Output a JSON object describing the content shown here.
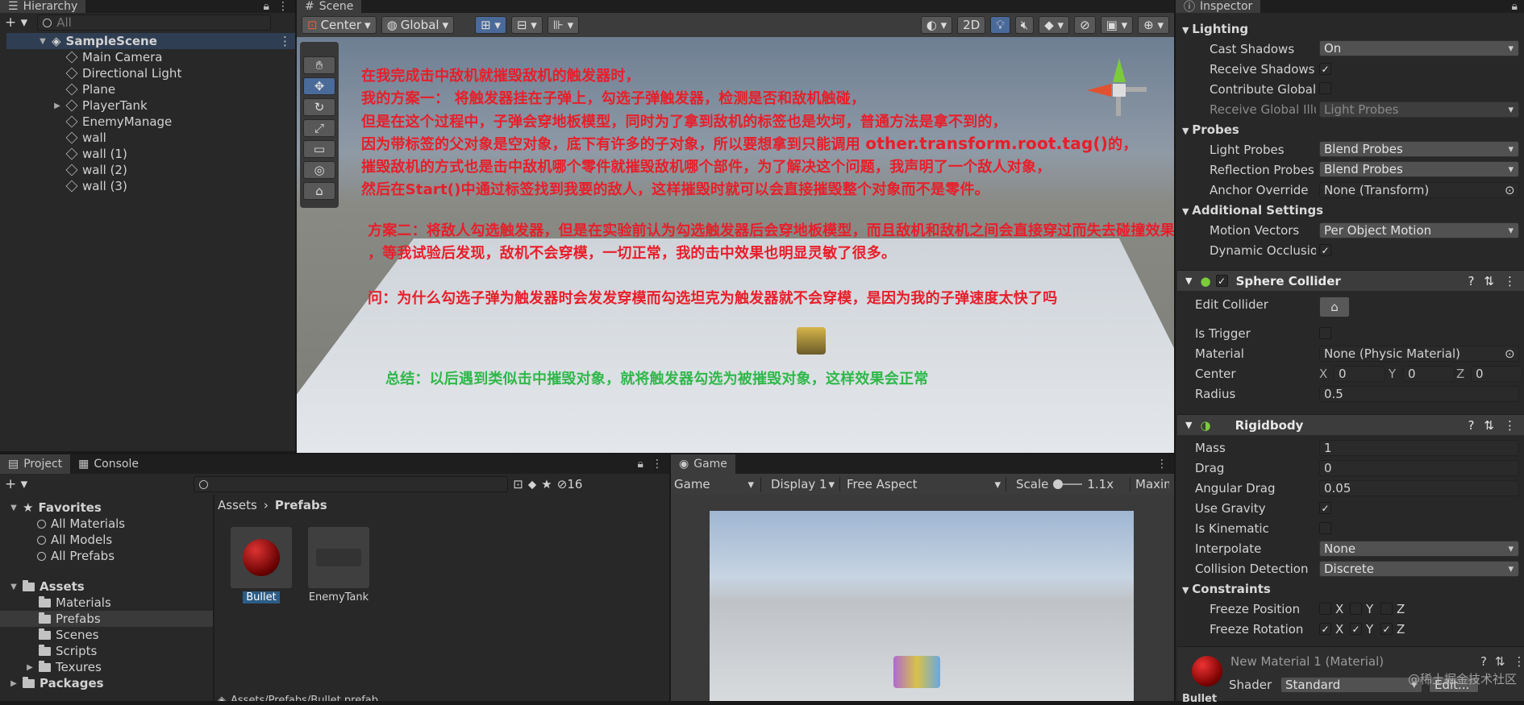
{
  "hierarchy": {
    "tab": "Hierarchy",
    "search_placeholder": "All",
    "scene": "SampleScene",
    "items": [
      "Main Camera",
      "Directional Light",
      "Plane",
      "PlayerTank",
      "EnemyManage",
      "wall",
      "wall (1)",
      "wall (2)",
      "wall (3)"
    ]
  },
  "scene": {
    "tab": "Scene",
    "pivot": "Center",
    "space": "Global",
    "mode2d": "2D"
  },
  "annotations": {
    "l1": "在我完成击中敌机就摧毁敌机的触发器时，",
    "l2": "我的方案一： 将触发器挂在子弹上，勾选子弹触发器，检测是否和敌机触碰，",
    "l3": "但是在这个过程中，子弹会穿地板模型，同时为了拿到敌机的标签也是坎坷，普通方法是拿不到的，",
    "l4a": "因为带标签的父对象是空对象，底下有许多的子对象，所以要想拿到只能调用 ",
    "l4b": "other.transform.root.tag()",
    "l4c": "的，",
    "l5": "摧毁敌机的方式也是击中敌机哪个零件就摧毁敌机哪个部件，为了解决这个问题，我声明了一个敌人对象，",
    "l6": "然后在Start()中通过标签找到我要的敌人，这样摧毁时就可以会直接摧毁整个对象而不是零件。",
    "l7": "方案二：将敌人勾选触发器，但是在实验前认为勾选触发器后会穿地板模型，而且敌机和敌机之间会直接穿过而失去碰撞效果",
    "l8": "，等我试验后发现，敌机不会穿模，一切正常，我的击中效果也明显灵敏了很多。",
    "l9": "问：为什么勾选子弹为触发器时会发发穿模而勾选坦克为触发器就不会穿模，是因为我的子弹速度太快了吗",
    "l10": "总结：以后遇到类似击中摧毁对象，就将触发器勾选为被摧毁对象，这样效果会正常"
  },
  "project": {
    "tab": "Project",
    "tab2": "Console",
    "count": "16",
    "favorites": "Favorites",
    "fav_items": [
      "All Materials",
      "All Models",
      "All Prefabs"
    ],
    "assets": "Assets",
    "asset_items": [
      "Materials",
      "Prefabs",
      "Scenes",
      "Scripts",
      "Texures"
    ],
    "packages": "Packages",
    "breadcrumb": [
      "Assets",
      "Prefabs"
    ],
    "files": [
      {
        "name": "Bullet"
      },
      {
        "name": "EnemyTank"
      }
    ],
    "path": "Assets/Prefabs/Bullet.prefab"
  },
  "game": {
    "tab": "Game",
    "mode": "Game",
    "display": "Display 1",
    "aspect": "Free Aspect",
    "scale_label": "Scale",
    "scale": "1.1x",
    "maxi": "Maxim"
  },
  "inspector": {
    "tab": "Inspector",
    "lighting": "Lighting",
    "cast_shadows": "Cast Shadows",
    "cast_shadows_val": "On",
    "receive_shadows": "Receive Shadows",
    "contribute_gi": "Contribute Global I",
    "receive_gi": "Receive Global Illu",
    "receive_gi_val": "Light Probes",
    "probes": "Probes",
    "light_probes": "Light Probes",
    "light_probes_val": "Blend Probes",
    "reflection_probes": "Reflection Probes",
    "reflection_probes_val": "Blend Probes",
    "anchor_override": "Anchor Override",
    "anchor_override_val": "None (Transform)",
    "additional": "Additional Settings",
    "motion_vectors": "Motion Vectors",
    "motion_vectors_val": "Per Object Motion",
    "dynamic_occlusion": "Dynamic Occlusion",
    "sphere_collider": "Sphere Collider",
    "edit_collider": "Edit Collider",
    "is_trigger": "Is Trigger",
    "material": "Material",
    "material_val": "None (Physic Material)",
    "center": "Center",
    "cx": "0",
    "cy": "0",
    "cz": "0",
    "radius": "Radius",
    "radius_val": "0.5",
    "rigidbody": "Rigidbody",
    "mass": "Mass",
    "mass_val": "1",
    "drag": "Drag",
    "drag_val": "0",
    "angular_drag": "Angular Drag",
    "angular_drag_val": "0.05",
    "use_gravity": "Use Gravity",
    "is_kinematic": "Is Kinematic",
    "interpolate": "Interpolate",
    "interpolate_val": "None",
    "collision_detection": "Collision Detection",
    "collision_detection_val": "Discrete",
    "constraints": "Constraints",
    "freeze_position": "Freeze Position",
    "freeze_rotation": "Freeze Rotation",
    "axis_x": "X",
    "axis_y": "Y",
    "axis_z": "Z",
    "material_name": "New Material 1 (Material)",
    "shader": "Shader",
    "shader_val": "Standard",
    "edit": "Edit...",
    "bottom": "Bullet",
    "watermark": "@稀土掘金技术社区"
  }
}
